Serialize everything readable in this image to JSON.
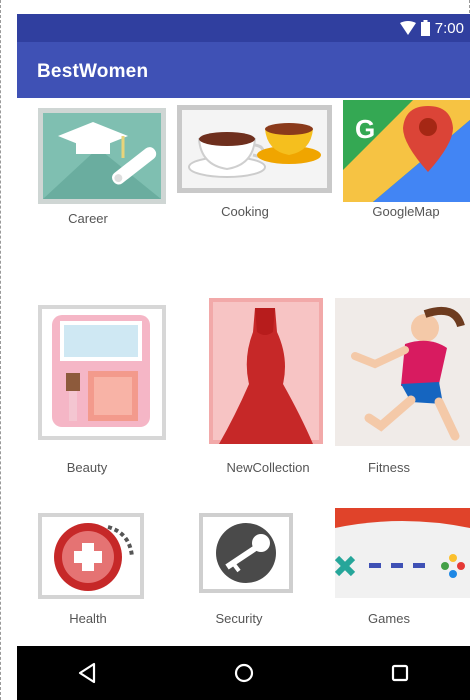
{
  "status_bar": {
    "time": "7:00",
    "icons": [
      "wifi-icon",
      "battery-icon"
    ]
  },
  "app_bar": {
    "title": "BestWomen"
  },
  "grid": {
    "items": [
      {
        "label": "Career",
        "icon": "career-icon"
      },
      {
        "label": "Cooking",
        "icon": "cooking-icon"
      },
      {
        "label": "GoogleMap",
        "icon": "google-map-icon"
      },
      {
        "label": "Beauty",
        "icon": "beauty-icon"
      },
      {
        "label": "NewCollection",
        "icon": "new-collection-icon"
      },
      {
        "label": "Fitness",
        "icon": "fitness-icon"
      },
      {
        "label": "Health",
        "icon": "health-icon"
      },
      {
        "label": "Security",
        "icon": "security-icon"
      },
      {
        "label": "Games",
        "icon": "games-icon"
      }
    ]
  },
  "nav_bar": {
    "buttons": [
      "back-icon",
      "home-icon",
      "recents-icon"
    ]
  },
  "colors": {
    "status_bar": "#303F9F",
    "app_bar": "#3F51B5",
    "nav_bar": "#000000"
  }
}
